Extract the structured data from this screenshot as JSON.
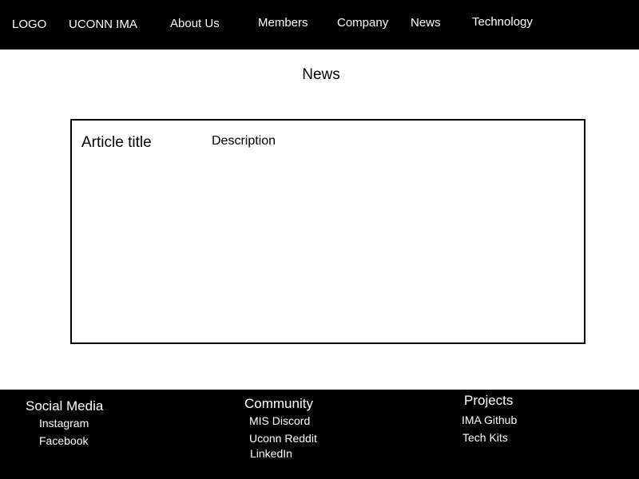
{
  "header": {
    "logo": "LOGO",
    "brand": "UCONN IMA",
    "nav": {
      "about": "About Us",
      "members": "Members",
      "company": "Company",
      "news": "News",
      "technology": "Technology"
    }
  },
  "main": {
    "title": "News",
    "article": {
      "title": "Article title",
      "description": "Description"
    }
  },
  "footer": {
    "social": {
      "heading": "Social Media",
      "links": [
        "Instagram",
        "Facebook"
      ]
    },
    "community": {
      "heading": "Community",
      "links": [
        "MIS Discord",
        "Uconn Reddit",
        "LinkedIn"
      ]
    },
    "projects": {
      "heading": "Projects",
      "links": [
        "IMA Github",
        "Tech Kits"
      ]
    }
  },
  "colors": {
    "bar_background": "#000000",
    "bar_text": "#ffffff",
    "page_background": "#ffffff"
  }
}
